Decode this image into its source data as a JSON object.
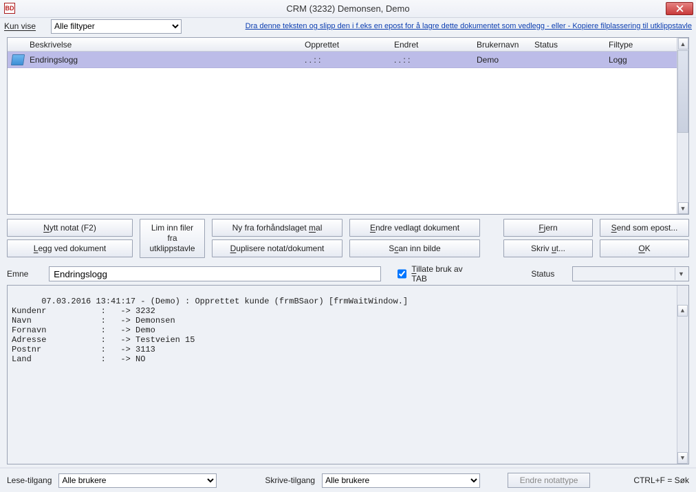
{
  "title": "CRM (3232) Demonsen, Demo",
  "toolbar1": {
    "kun_vise": "Kun vise",
    "filter_value": "Alle filtyper",
    "hint_link": "Dra denne teksten og slipp den i f.eks en epost for å lagre dette dokumentet som vedlegg - eller - Kopiere filplassering til utklippstavle"
  },
  "grid": {
    "headers": {
      "besc": "Beskrivelse",
      "oppr": "Opprettet",
      "endr": "Endret",
      "brk": "Brukernavn",
      "sta": "Status",
      "fil": "Filtype"
    },
    "rows": [
      {
        "besc": "Endringslogg",
        "oppr": ". .     : :",
        "endr": ". .     : :",
        "brk": "Demo",
        "sta": "",
        "fil": "Logg"
      }
    ]
  },
  "buttons": {
    "nytt_notat": "Nytt notat (F2)",
    "legg_ved": "Legg ved dokument",
    "lim_inn": "Lim inn filer\nfra\nutklippstavle",
    "ny_fra": "Ny fra forhåndslaget mal",
    "duplisere": "Duplisere notat/dokument",
    "endre_vedlagt": "Endre vedlagt dokument",
    "scan": "Scan inn bilde",
    "fjern": "Fjern",
    "skriv_ut": "Skriv ut...",
    "send_som": "Send som epost...",
    "ok": "OK"
  },
  "emne": {
    "label": "Emne",
    "value": "Endringslogg",
    "tab_label": "Tillate bruk av TAB",
    "tab_checked": true,
    "status_label": "Status"
  },
  "log": "07.03.2016 13:41:17 - (Demo) : Opprettet kunde (frmBSaor) [frmWaitWindow.]\nKundenr           :   -> 3232\nNavn              :   -> Demonsen\nFornavn           :   -> Demo\nAdresse           :   -> Testveien 15\nPostnr            :   -> 3113\nLand              :   -> NO",
  "bottom": {
    "lese": "Lese-tilgang",
    "lese_value": "Alle brukere",
    "skrive": "Skrive-tilgang",
    "skrive_value": "Alle brukere",
    "endre_type": "Endre notattype",
    "hint": "CTRL+F = Søk"
  }
}
